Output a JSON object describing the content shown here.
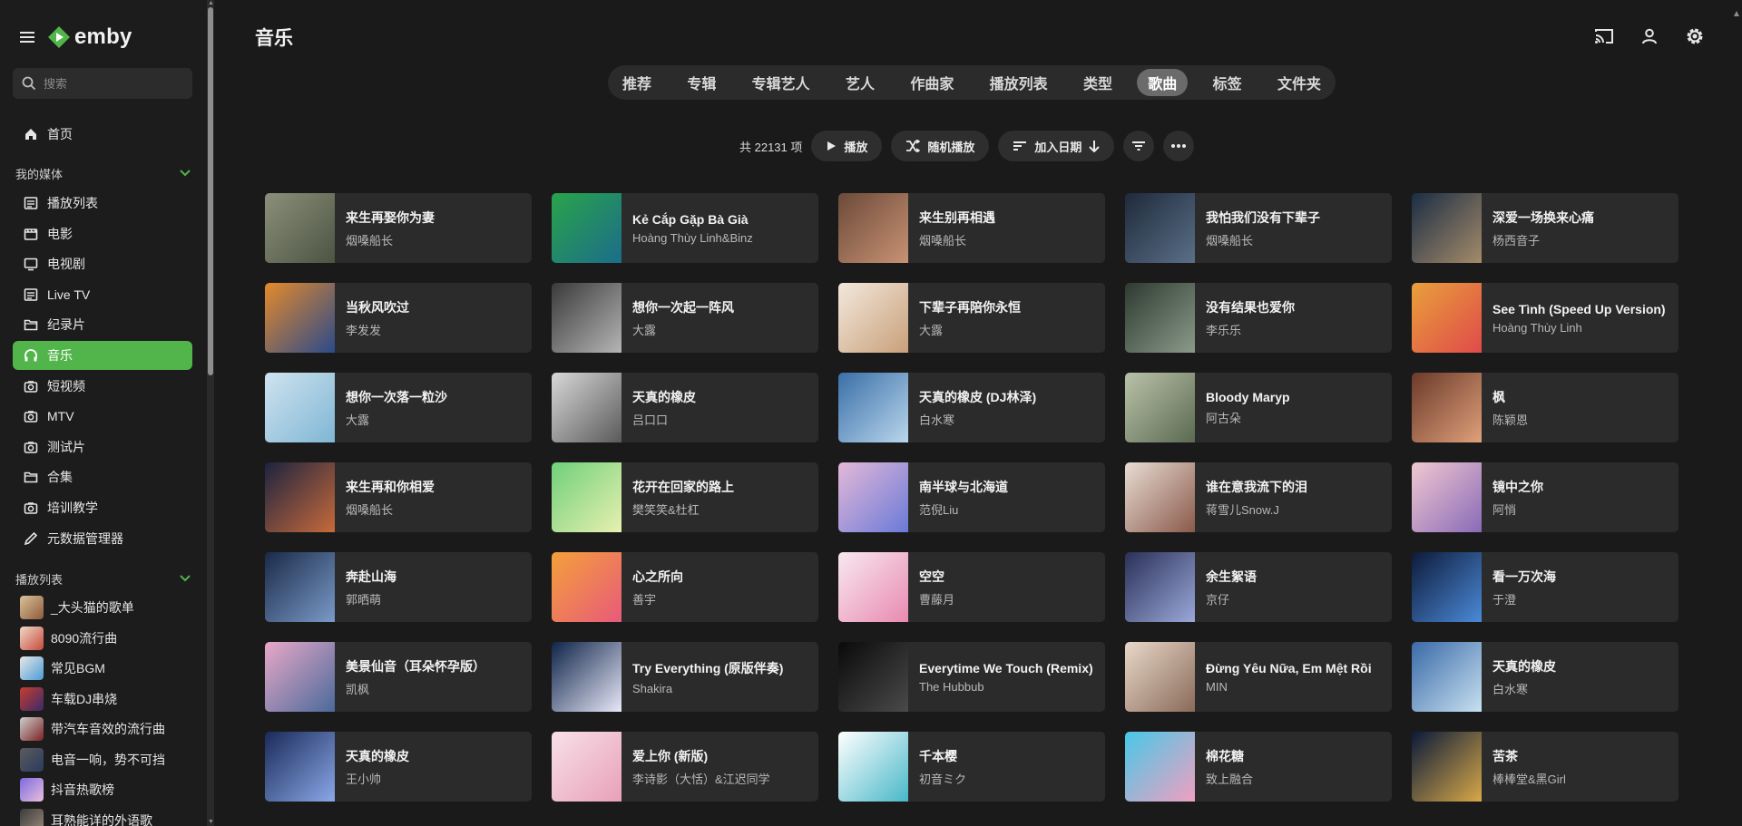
{
  "sidebar": {
    "logo_text": "emby",
    "search_placeholder": "搜索",
    "home_label": "首页",
    "my_media_label": "我的媒体",
    "media_items": [
      {
        "label": "播放列表",
        "icon": "list-icon"
      },
      {
        "label": "电影",
        "icon": "movie-icon"
      },
      {
        "label": "电视剧",
        "icon": "tv-icon"
      },
      {
        "label": "Live TV",
        "icon": "list-icon"
      },
      {
        "label": "纪录片",
        "icon": "folder-icon"
      },
      {
        "label": "音乐",
        "icon": "headphones-icon"
      },
      {
        "label": "短视频",
        "icon": "camera-icon"
      },
      {
        "label": "MTV",
        "icon": "camera-icon"
      },
      {
        "label": "测试片",
        "icon": "camera-icon"
      },
      {
        "label": "合集",
        "icon": "folder-icon"
      },
      {
        "label": "培训教学",
        "icon": "camera-icon"
      },
      {
        "label": "元数据管理器",
        "icon": "pencil-icon"
      }
    ],
    "playlists_label": "播放列表",
    "playlists": [
      {
        "label": "_大头猫的歌单"
      },
      {
        "label": "8090流行曲"
      },
      {
        "label": "常见BGM"
      },
      {
        "label": "车载DJ串烧"
      },
      {
        "label": "带汽车音效的流行曲"
      },
      {
        "label": "电音一响，势不可挡"
      },
      {
        "label": "抖音热歌榜"
      },
      {
        "label": "耳熟能详的外语歌"
      }
    ]
  },
  "header": {
    "title": "音乐",
    "icons": [
      "cast-icon",
      "user-icon",
      "settings-icon"
    ]
  },
  "tabs": [
    "推荐",
    "专辑",
    "专辑艺人",
    "艺人",
    "作曲家",
    "播放列表",
    "类型",
    "歌曲",
    "标签",
    "文件夹"
  ],
  "active_tab": "歌曲",
  "toolbar": {
    "count": "共 22131 项",
    "play": "播放",
    "shuffle": "随机播放",
    "sort": "加入日期"
  },
  "songs": [
    {
      "title": "来生再娶你为妻",
      "artist": "烟嗓船长"
    },
    {
      "title": "Kẻ Cắp Gặp Bà Già",
      "artist": "Hoàng Thùy Linh&Binz"
    },
    {
      "title": "来生别再相遇",
      "artist": "烟嗓船长"
    },
    {
      "title": "我怕我们没有下辈子",
      "artist": "烟嗓船长"
    },
    {
      "title": "深爱一场换来心痛",
      "artist": "杨西音子"
    },
    {
      "title": "当秋风吹过",
      "artist": "李发发"
    },
    {
      "title": "想你一次起一阵风",
      "artist": "大露"
    },
    {
      "title": "下辈子再陪你永恒",
      "artist": "大露"
    },
    {
      "title": "没有结果也爱你",
      "artist": "李乐乐"
    },
    {
      "title": "See Tình (Speed Up Version)",
      "artist": "Hoàng Thùy Linh"
    },
    {
      "title": "想你一次落一粒沙",
      "artist": "大露"
    },
    {
      "title": "天真的橡皮",
      "artist": "吕口口"
    },
    {
      "title": "天真的橡皮 (DJ林泽)",
      "artist": "白水寒"
    },
    {
      "title": "Bloody Maryp",
      "artist": "阿古朵"
    },
    {
      "title": "枫",
      "artist": "陈颖恩"
    },
    {
      "title": "来生再和你相爱",
      "artist": "烟嗓船长"
    },
    {
      "title": "花开在回家的路上",
      "artist": "樊笑笑&杜杠"
    },
    {
      "title": "南半球与北海道",
      "artist": "范倪Liu"
    },
    {
      "title": "谁在意我流下的泪",
      "artist": "蒋雪儿Snow.J"
    },
    {
      "title": "镜中之你",
      "artist": "阿悄"
    },
    {
      "title": "奔赴山海",
      "artist": "郭晒萌"
    },
    {
      "title": "心之所向",
      "artist": "善宇"
    },
    {
      "title": "空空",
      "artist": "曹藤月"
    },
    {
      "title": "余生絮语",
      "artist": "京仔"
    },
    {
      "title": "看一万次海",
      "artist": "于澄"
    },
    {
      "title": "美景仙音（耳朵怀孕版）",
      "artist": "凯枫"
    },
    {
      "title": "Try Everything (原版伴奏)",
      "artist": "Shakira"
    },
    {
      "title": "Everytime We Touch (Remix)",
      "artist": "The Hubbub"
    },
    {
      "title": "Đừng Yêu Nữa, Em Mệt Rồi",
      "artist": "MIN"
    },
    {
      "title": "天真的橡皮",
      "artist": "白水寒"
    },
    {
      "title": "天真的橡皮",
      "artist": "王小帅"
    },
    {
      "title": "爱上你 (新版)",
      "artist": "李诗影（大恬）&江迟同学"
    },
    {
      "title": "千本樱",
      "artist": "初音ミク"
    },
    {
      "title": "棉花糖",
      "artist": "致上融合"
    },
    {
      "title": "苦茶",
      "artist": "棒棒堂&黑Girl"
    }
  ],
  "colors": {
    "accent": "#52b54b",
    "background": "#1a1a1a",
    "card": "#2b2b2b"
  }
}
